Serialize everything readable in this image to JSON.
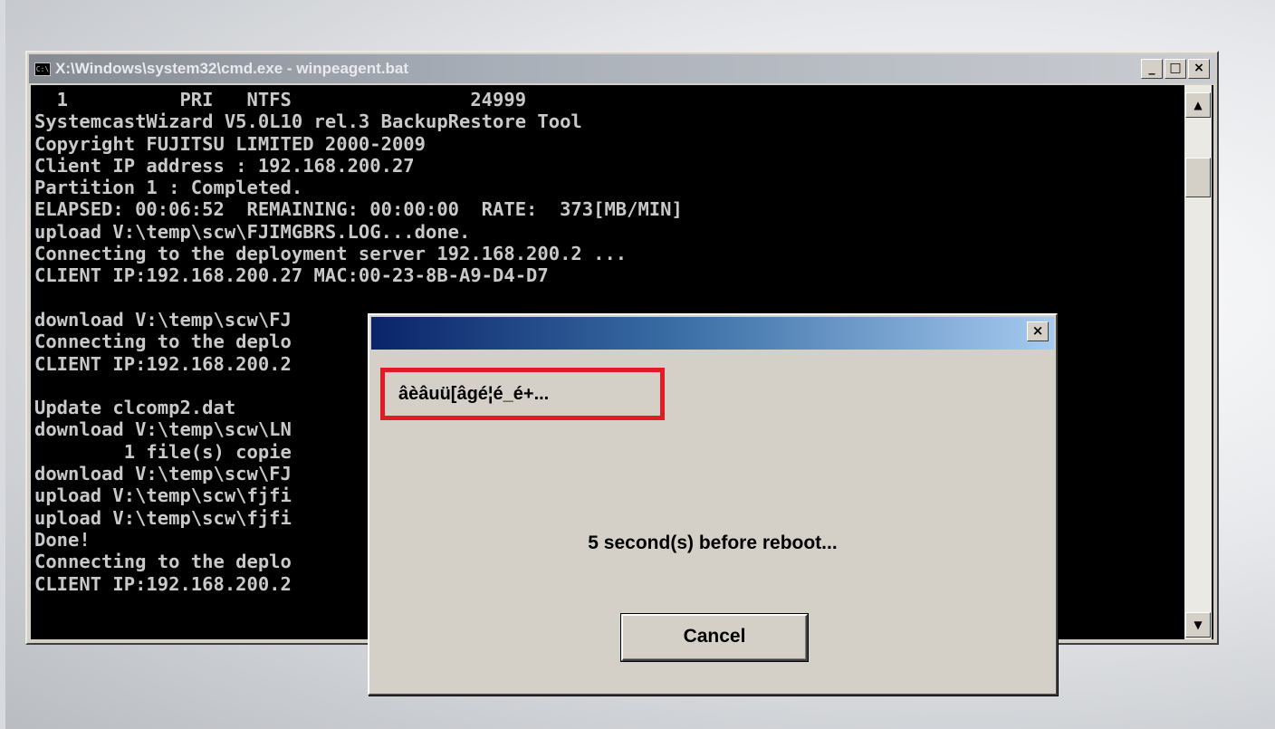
{
  "cmd_window": {
    "title": "X:\\Windows\\system32\\cmd.exe - winpeagent.bat",
    "icon_label": "C:\\",
    "buttons": {
      "minimize": "_",
      "maximize": "□",
      "close": "×"
    },
    "console_lines": [
      "  1          PRI   NTFS                24999",
      "SystemcastWizard V5.0L10 rel.3 BackupRestore Tool",
      "Copyright FUJITSU LIMITED 2000-2009",
      "Client IP address : 192.168.200.27",
      "Partition 1 : Completed.",
      "ELAPSED: 00:06:52  REMAINING: 00:00:00  RATE:  373[MB/MIN]",
      "upload V:\\temp\\scw\\FJIMGBRS.LOG...done.",
      "Connecting to the deployment server 192.168.200.2 ...",
      "CLIENT IP:192.168.200.27 MAC:00-23-8B-A9-D4-D7",
      "",
      "download V:\\temp\\scw\\FJ",
      "Connecting to the deplo",
      "CLIENT IP:192.168.200.2",
      "",
      "Update clcomp2.dat",
      "download V:\\temp\\scw\\LN",
      "        1 file(s) copie",
      "download V:\\temp\\scw\\FJ",
      "upload V:\\temp\\scw\\fjfi",
      "upload V:\\temp\\scw\\fjfi",
      "Done!",
      "Connecting to the deplo",
      "CLIENT IP:192.168.200.2"
    ],
    "scrollbar": {
      "up": "▲",
      "down": "▼"
    }
  },
  "dialog": {
    "title": "",
    "close_label": "×",
    "header_text": "âèâuü[âgé¦é_é+...",
    "message": "5 second(s) before reboot...",
    "cancel_label": "Cancel",
    "highlight_color": "#e01b24"
  }
}
